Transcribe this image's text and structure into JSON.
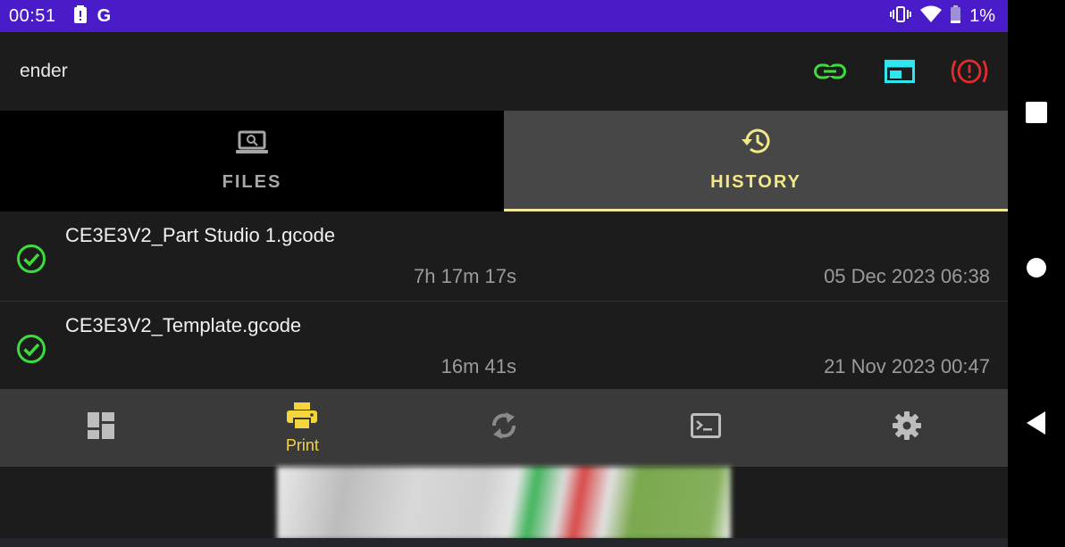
{
  "status_bar": {
    "time": "00:51",
    "g_label": "G",
    "battery_percent": "1%",
    "background_color": "#4a1bc9"
  },
  "app_bar": {
    "title": "ender",
    "actions": [
      {
        "name": "link-icon",
        "color": "#3ddc3d"
      },
      {
        "name": "dashboard-panel-icon",
        "color": "#2ee6f0"
      },
      {
        "name": "emergency-stop-icon",
        "color": "#e52b2b"
      }
    ]
  },
  "tabs": [
    {
      "label": "FILES",
      "icon": "laptop-search-icon",
      "selected": false
    },
    {
      "label": "HISTORY",
      "icon": "history-icon",
      "selected": true
    }
  ],
  "history": [
    {
      "filename": "CE3E3V2_Part Studio 1.gcode",
      "duration": "7h 17m 17s",
      "date": "05 Dec 2023 06:38",
      "status": "completed"
    },
    {
      "filename": "CE3E3V2_Template.gcode",
      "duration": "16m 41s",
      "date": "21 Nov 2023 00:47",
      "status": "completed"
    }
  ],
  "bottom_nav": [
    {
      "icon": "dashboard-icon",
      "label": "",
      "selected": false
    },
    {
      "icon": "printer-icon",
      "label": "Print",
      "selected": true
    },
    {
      "icon": "sync-icon",
      "label": "",
      "selected": false
    },
    {
      "icon": "console-icon",
      "label": "",
      "selected": false
    },
    {
      "icon": "settings-gear-icon",
      "label": "",
      "selected": false
    }
  ],
  "colors": {
    "accent": "#f3e887",
    "success": "#3ddc3d",
    "error": "#e52b2b",
    "app_background": "#1c1c1c"
  }
}
